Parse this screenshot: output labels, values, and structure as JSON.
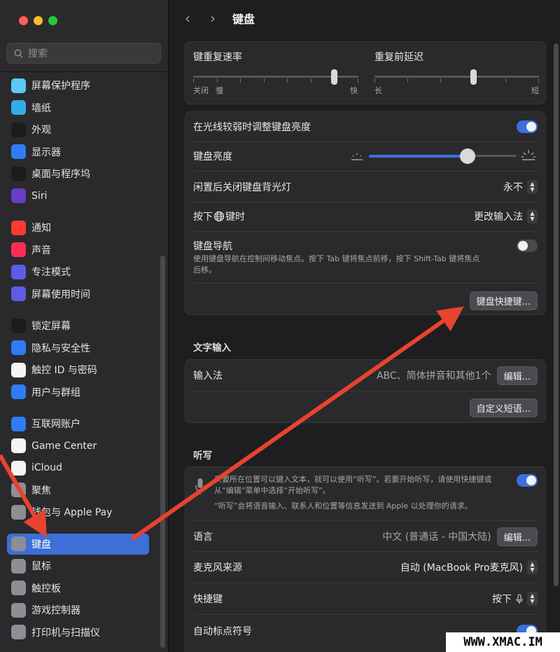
{
  "sidebar": {
    "search_placeholder": "搜索",
    "groups": [
      [
        {
          "label": "屏幕保护程序",
          "icon": "screensaver-icon",
          "color": "#5ac8fa"
        },
        {
          "label": "墙纸",
          "icon": "wallpaper-icon",
          "color": "#32ade6"
        },
        {
          "label": "外观",
          "icon": "appearance-icon",
          "color": "#1c1c1e"
        },
        {
          "label": "显示器",
          "icon": "display-icon",
          "color": "#2f7cf6"
        },
        {
          "label": "桌面与程序坞",
          "icon": "dock-icon",
          "color": "#1c1c1e"
        },
        {
          "label": "Siri",
          "icon": "siri-icon",
          "color": "#6a3cc7"
        }
      ],
      [
        {
          "label": "通知",
          "icon": "notifications-icon",
          "color": "#ff3b30"
        },
        {
          "label": "声音",
          "icon": "sound-icon",
          "color": "#ff2d55"
        },
        {
          "label": "专注模式",
          "icon": "focus-icon",
          "color": "#5e5ce6"
        },
        {
          "label": "屏幕使用时间",
          "icon": "screen-time-icon",
          "color": "#5e5ce6"
        }
      ],
      [
        {
          "label": "锁定屏幕",
          "icon": "lock-screen-icon",
          "color": "#1c1c1e"
        },
        {
          "label": "隐私与安全性",
          "icon": "privacy-hand-icon",
          "color": "#2f7cf6"
        },
        {
          "label": "触控 ID 与密码",
          "icon": "fingerprint-icon",
          "color": "#f5f5f7"
        },
        {
          "label": "用户与群组",
          "icon": "users-icon",
          "color": "#2f7cf6"
        }
      ],
      [
        {
          "label": "互联网账户",
          "icon": "internet-accounts-icon",
          "color": "#2f7cf6"
        },
        {
          "label": "Game Center",
          "icon": "game-center-icon",
          "color": "#f5f5f7"
        },
        {
          "label": "iCloud",
          "icon": "icloud-icon",
          "color": "#f5f5f7"
        },
        {
          "label": "聚焦",
          "icon": "spotlight-icon",
          "color": "#8e8e93"
        },
        {
          "label": "钱包与 Apple Pay",
          "icon": "wallet-icon",
          "color": "#8e8e93"
        }
      ],
      [
        {
          "label": "键盘",
          "icon": "keyboard-icon",
          "color": "#8e8e93",
          "active": true
        },
        {
          "label": "鼠标",
          "icon": "mouse-icon",
          "color": "#8e8e93"
        },
        {
          "label": "触控板",
          "icon": "trackpad-icon",
          "color": "#8e8e93"
        },
        {
          "label": "游戏控制器",
          "icon": "game-controller-icon",
          "color": "#8e8e93"
        },
        {
          "label": "打印机与扫描仪",
          "icon": "printer-icon",
          "color": "#8e8e93"
        }
      ]
    ]
  },
  "header": {
    "back": "‹",
    "forward": "›",
    "title": "键盘"
  },
  "repeat": {
    "key_repeat_label": "键重复速率",
    "key_repeat_min": "关闭",
    "key_repeat_slow": "慢",
    "key_repeat_fast": "快",
    "key_repeat_value": 0.85,
    "delay_label": "重复前延迟",
    "delay_long": "长",
    "delay_short": "短",
    "delay_value": 0.6
  },
  "backlight": {
    "auto_brightness_label": "在光线较弱时调整键盘亮度",
    "auto_brightness_on": true,
    "brightness_label": "键盘亮度",
    "brightness_value": 0.67,
    "idle_off_label": "闲置后关闭键盘背光灯",
    "idle_off_value": "永不",
    "globe_label_prefix": "按下",
    "globe_label_suffix": "键时",
    "globe_value": "更改输入法",
    "nav_label": "键盘导航",
    "nav_desc": "使用键盘导航在控制间移动焦点。按下 Tab 键将焦点前移，按下 Shift-Tab 键将焦点后移。",
    "nav_on": false,
    "shortcuts_button": "键盘快捷键..."
  },
  "text_input": {
    "section": "文字输入",
    "input_label": "输入法",
    "input_value": "ABC、简体拼音和其他1个",
    "edit_button": "编辑...",
    "replacements_button": "自定义短语..."
  },
  "dictation": {
    "section": "听写",
    "desc1": "只要所在位置可以键入文本，就可以使用“听写”。若要开始听写，请使用快捷键或从“编辑”菜单中选择“开始听写”。",
    "desc2": "“听写”会将语音输入、联系人和位置等信息发送到 Apple 以处理你的请求。",
    "on": true,
    "language_label": "语言",
    "language_value": "中文 (普通话 - 中国大陆)",
    "language_edit": "编辑...",
    "mic_label": "麦克风来源",
    "mic_value": "自动 (MacBook Pro麦克风)",
    "shortcut_label": "快捷键",
    "shortcut_value": "按下",
    "auto_punct_label": "自动标点符号"
  },
  "watermark": "WWW.XMAC.IM",
  "colors": {
    "accent": "#3b6fe0",
    "annotation_arrow": "#e8432e"
  }
}
